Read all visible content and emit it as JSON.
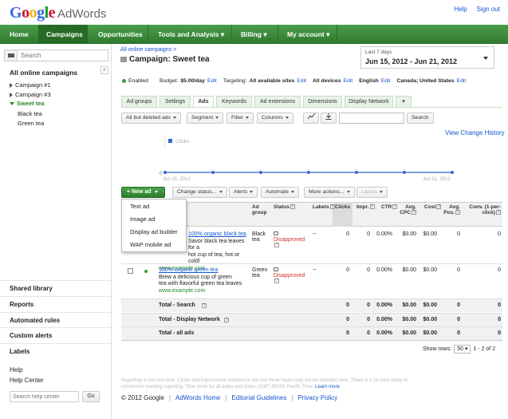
{
  "header": {
    "logo_google": "Google",
    "logo_product": "AdWords",
    "help": "Help",
    "sign_out": "Sign out"
  },
  "nav": {
    "home": "Home",
    "campaigns": "Campaigns",
    "opportunities": "Opportunities",
    "tools": "Tools and Analysis",
    "billing": "Billing",
    "account": "My account"
  },
  "sidebar": {
    "search_placeholder": "Search",
    "collapse": "«",
    "title": "All online campaigns",
    "campaigns": [
      "Campaign #1",
      "Campaign #3",
      "Sweet tea"
    ],
    "adgroups": [
      "Black tea",
      "Green tea"
    ],
    "sections": [
      "Shared library",
      "Reports",
      "Automated rules",
      "Custom alerts",
      "Labels"
    ],
    "help_title": "Help",
    "help_center": "Help Center",
    "help_search_placeholder": "Search help center",
    "go": "Go"
  },
  "main": {
    "breadcrumb": "All online campaigns >",
    "title": "Campaign: Sweet tea",
    "date_label": "Last 7 days",
    "date_range": "Jun 15, 2012 - Jun 21, 2012",
    "info": {
      "status": "Enabled",
      "budget_label": "Budget:",
      "budget_value": "$5.00/day",
      "edit": "Edit",
      "targeting_label": "Targeting:",
      "targeting_value": "All available sites",
      "devices": "All devices",
      "language": "English",
      "location": "Canada; United States"
    },
    "tabs": [
      "Ad groups",
      "Settings",
      "Ads",
      "Keywords",
      "Ad extensions",
      "Dimensions",
      "Display Network"
    ],
    "toolbar": {
      "filter_view": "All but deleted ads",
      "segment": "Segment",
      "filter": "Filter",
      "columns": "Columns",
      "search_button": "Search"
    },
    "view_history": "View Change History",
    "chart": {
      "legend": "Clicks",
      "start_date": "Jun 15, 2012",
      "end_date": "Jun 21, 2012",
      "y_label": "0"
    },
    "actions": {
      "new_ad": "+ New ad",
      "change_status": "Change status...",
      "alerts": "Alerts",
      "automate": "Automate",
      "more_actions": "More actions...",
      "labels": "Labels"
    },
    "new_ad_menu": [
      "Text ad",
      "Image ad",
      "Display ad builder",
      "WAP mobile ad"
    ]
  },
  "table": {
    "headers": {
      "ad_group": "Ad group",
      "status": "Status",
      "labels": "Labels",
      "clicks": "Clicks",
      "impr": "Impr.",
      "ctr": "CTR",
      "avg_cpc": "Avg. CPC",
      "cost": "Cost",
      "avg_pos": "Avg. Pos.",
      "conv": "Conv. (1-per-click)"
    },
    "rows": [
      {
        "headline": "100% organic black tea",
        "line1": "Savor black tea leaves for a",
        "line2": "hot cup of tea, hot or cold!",
        "display_url": "www.example.com",
        "ad_group": "Black tea",
        "status": "Disapproved",
        "labels": "--",
        "clicks": "0",
        "impr": "0",
        "ctr": "0.00%",
        "avg_cpc": "$0.00",
        "cost": "$0.00",
        "avg_pos": "0",
        "conv": "0"
      },
      {
        "headline": "100% organic green tea",
        "line1": "Brew a delicious cup of green",
        "line2": "tea with flavorful green tea leaves",
        "display_url": "www.example.com",
        "ad_group": "Green tea",
        "status": "Disapproved",
        "labels": "--",
        "clicks": "0",
        "impr": "0",
        "ctr": "0.00%",
        "avg_cpc": "$0.00",
        "cost": "$0.00",
        "avg_pos": "0",
        "conv": "0"
      }
    ],
    "totals": [
      {
        "label": "Total - Search",
        "clicks": "0",
        "impr": "0",
        "ctr": "0.00%",
        "avg_cpc": "$0.00",
        "cost": "$0.00",
        "avg_pos": "0",
        "conv": "0"
      },
      {
        "label": "Total - Display Network",
        "clicks": "0",
        "impr": "0",
        "ctr": "0.00%",
        "avg_cpc": "$0.00",
        "cost": "$0.00",
        "avg_pos": "0",
        "conv": "0"
      },
      {
        "label": "Total - all ads",
        "clicks": "0",
        "impr": "0",
        "ctr": "0.00%",
        "avg_cpc": "$0.00",
        "cost": "$0.00",
        "avg_pos": "0",
        "conv": "0"
      }
    ],
    "show_rows_label": "Show rows:",
    "show_rows_value": "50",
    "pagination": "1 - 2 of 2"
  },
  "footer": {
    "note": "Reporting is not real-time. Clicks and impressions received in the last three hours may not be included here. There is a 24-hour delay in conversion tracking reporting. Time zone for all dates and times: (GMT-08:00) Pacific Time.",
    "learn_more": "Learn more",
    "copyright": "© 2012 Google",
    "adwords_home": "AdWords Home",
    "editorial": "Editorial Guidelines",
    "privacy": "Privacy Policy"
  },
  "colors": {
    "nav_green": "#3d8a3d",
    "link_blue": "#1155cc",
    "status_green": "#2e9e2e",
    "disapproved_red": "#cc3333"
  }
}
